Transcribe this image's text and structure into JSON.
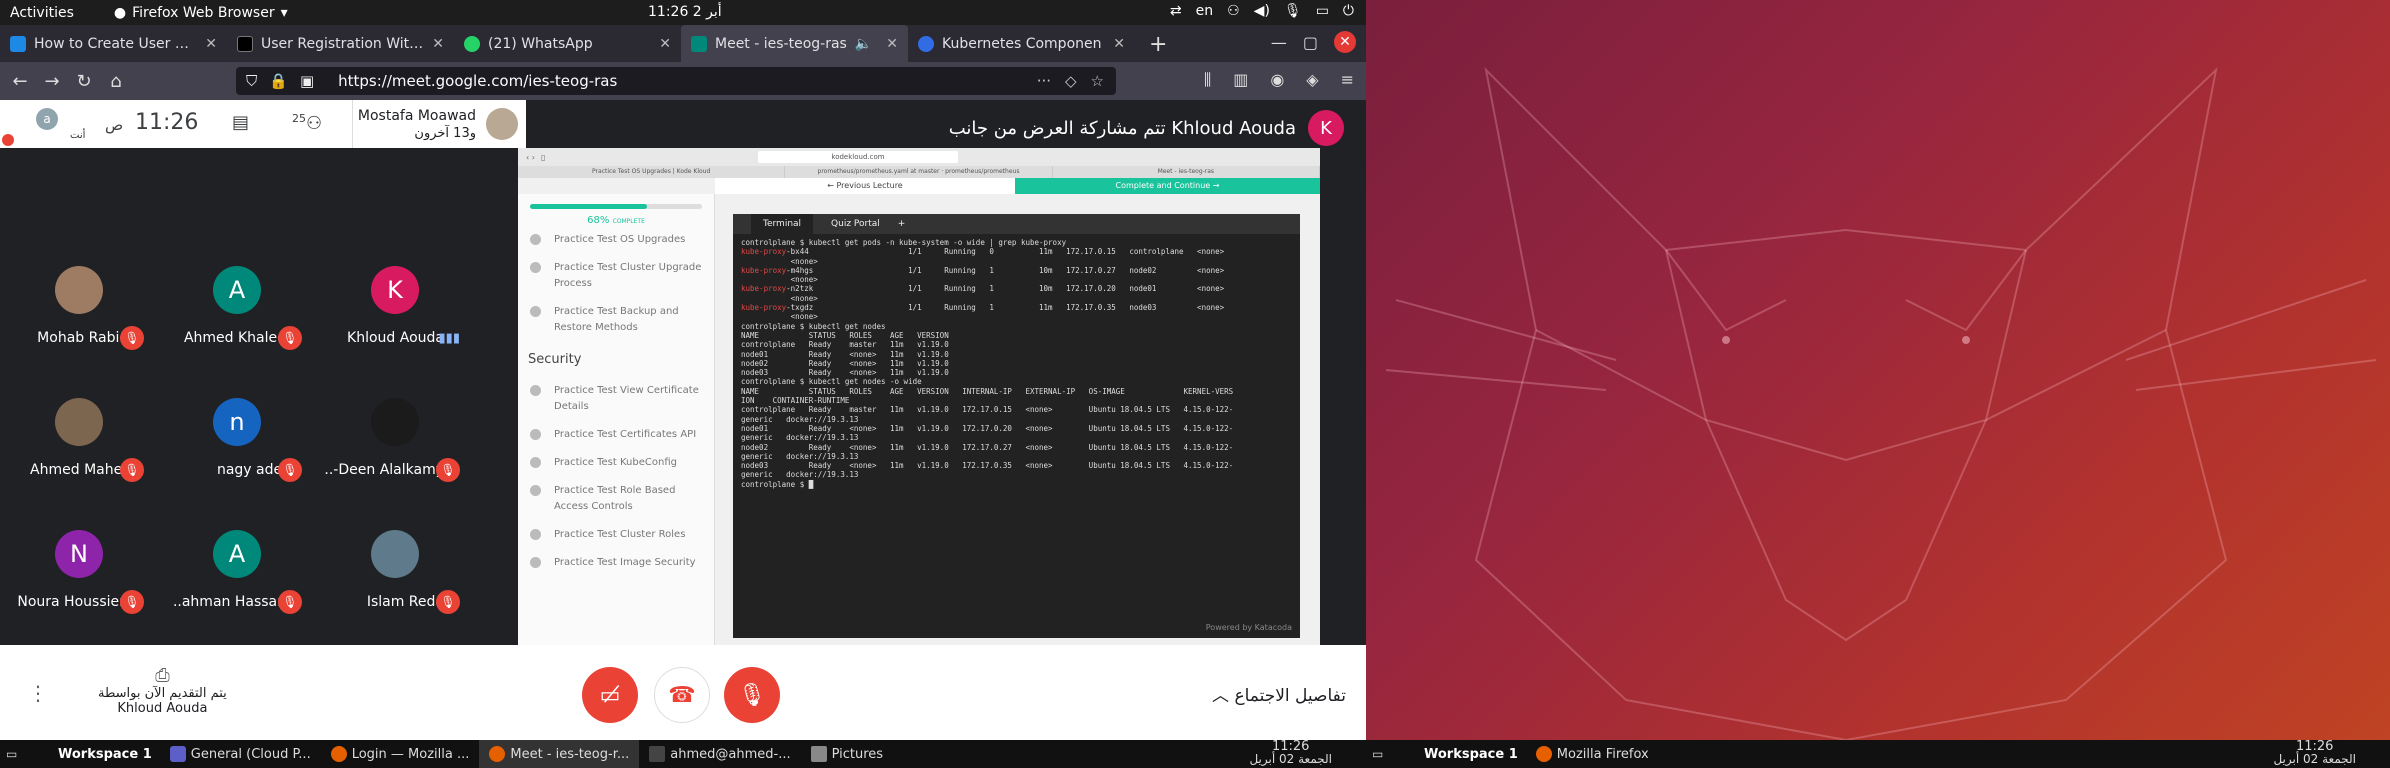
{
  "topbar": {
    "activities": "Activities",
    "app": "Firefox Web Browser",
    "clock": "11:26  أبر 2",
    "lang": "en"
  },
  "tabs": [
    {
      "label": "How to Create User Sign",
      "color": "#1e88e5"
    },
    {
      "label": "User Registration With E",
      "color": "#000000"
    },
    {
      "label": "(21) WhatsApp",
      "color": "#25d366"
    },
    {
      "label": "Meet - ies-teog-ras",
      "color": "#00897b"
    },
    {
      "label": "Kubernetes Componen",
      "color": "#326ce5"
    }
  ],
  "url": "https://meet.google.com/ies-teog-ras",
  "meet": {
    "self_label": "أنت",
    "self_initial": "a",
    "time": "11:26",
    "time_suffix": "ص",
    "people_count": "25",
    "presenter_name": "Mostafa Moawad",
    "presenter_others": "و13 آخرون",
    "share_banner": "تتم مشاركة العرض من جانب Khloud Aouda",
    "share_initial": "K",
    "participants": [
      {
        "name": "Mohab Rabie",
        "initial": "",
        "color": "#9e7b63",
        "speaking": false
      },
      {
        "name": "Ahmed Khaled",
        "initial": "A",
        "color": "#00897b",
        "speaking": false
      },
      {
        "name": "Khloud Aouda",
        "initial": "K",
        "color": "#d81b60",
        "speaking": true
      },
      {
        "name": "Ahmed Maher",
        "initial": "",
        "color": "#7d6650",
        "speaking": false
      },
      {
        "name": "nagy adel",
        "initial": "n",
        "color": "#1565c0",
        "speaking": false
      },
      {
        "name": "..-Deen Alalkamy",
        "initial": "",
        "color": "#1b1b1b",
        "speaking": false
      },
      {
        "name": "Noura Houssien",
        "initial": "N",
        "color": "#8e24aa",
        "speaking": false
      },
      {
        "name": "..ahman Hassan",
        "initial": "A",
        "color": "#00897b",
        "speaking": false
      },
      {
        "name": "Islam Reda",
        "initial": "",
        "color": "#5f7a8a",
        "speaking": false
      }
    ],
    "present_line1": "يتم التقديم الآن بواسطة",
    "present_line2": "Khloud Aouda",
    "details": "تفاصيل الاجتماع"
  },
  "shared": {
    "url": "kodekloud.com",
    "tabs": [
      "Practice Test OS Upgrades | Kode Kloud",
      "prometheus/prometheus.yaml at master · prometheus/prometheus",
      "Meet - ies-teog-ras",
      ""
    ],
    "prev": "← Previous Lecture",
    "next": "Complete and Continue →",
    "progress": "68%",
    "progress_label": "COMPLETE",
    "sidebar": [
      "Practice Test OS Upgrades",
      "Practice Test Cluster Upgrade Process",
      "Practice Test Backup and Restore Methods"
    ],
    "section": "Security",
    "sidebar2": [
      "Practice Test View Certificate Details",
      "Practice Test Certificates API",
      "Practice Test KubeConfig",
      "Practice Test Role Based Access Controls",
      "Practice Test Cluster Roles",
      "Practice Test Image Security"
    ],
    "term_tabs": [
      "Terminal",
      "Quiz Portal",
      "+"
    ],
    "footer": "Powered by Katacoda"
  },
  "taskbar": {
    "ws": "Workspace 1",
    "items": [
      "General (Cloud P...",
      "Login — Mozilla ...",
      "Meet - ies-teog-r...",
      "ahmed@ahmed-...",
      "Pictures"
    ],
    "time": "11:26",
    "date": "الجمعة 02 أبريل",
    "ws2": "Workspace 1",
    "item2": "Mozilla Firefox"
  }
}
